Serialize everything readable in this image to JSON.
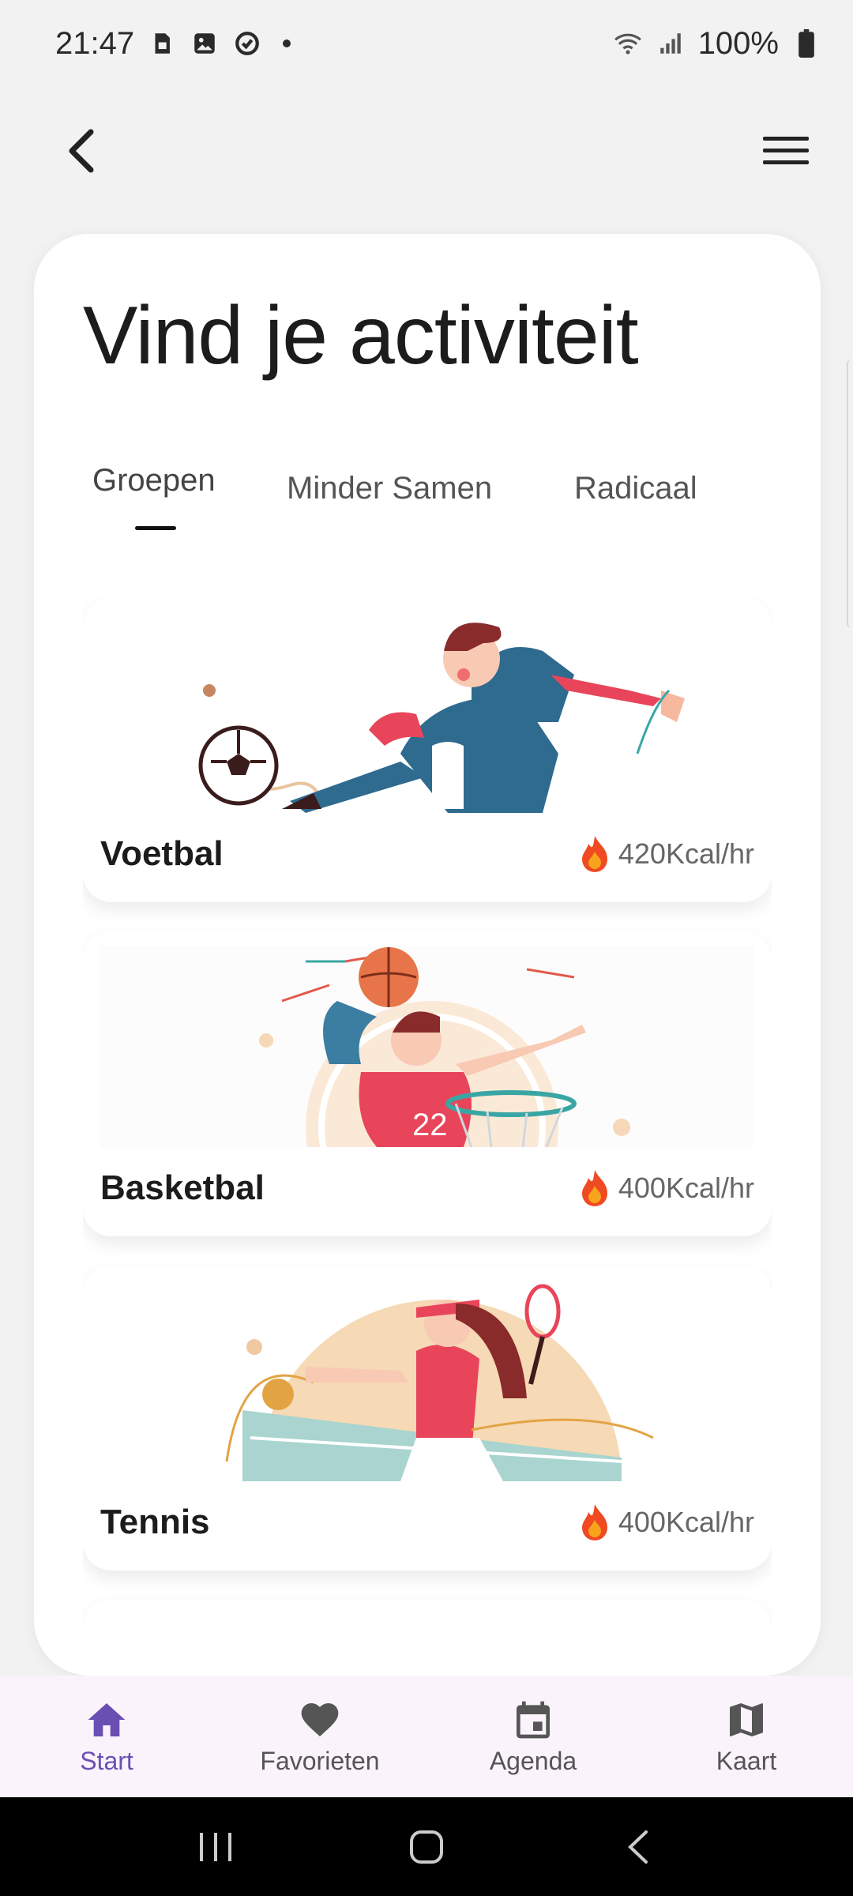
{
  "status_bar": {
    "time": "21:47",
    "battery": "100%",
    "icons": [
      "sim-icon",
      "gallery-icon",
      "sync-icon",
      "wifi-icon",
      "signal-icon",
      "battery-icon"
    ]
  },
  "app_bar": {
    "back_icon": "chevron-left-icon",
    "menu_icon": "hamburger-menu-icon"
  },
  "main": {
    "title": "Vind je activiteit",
    "tabs": [
      {
        "label": "Groepen",
        "active": true
      },
      {
        "label": "Minder Samen",
        "active": false
      },
      {
        "label": "Radicaal",
        "active": false
      }
    ],
    "activities": [
      {
        "name": "Voetbal",
        "kcal": "420Kcal/hr",
        "icon": "soccer-illustration"
      },
      {
        "name": "Basketbal",
        "kcal": "400Kcal/hr",
        "icon": "basketball-illustration"
      },
      {
        "name": "Tennis",
        "kcal": "400Kcal/hr",
        "icon": "tennis-illustration"
      }
    ]
  },
  "bottom_nav": {
    "items": [
      {
        "label": "Start",
        "icon": "home-icon",
        "active": true
      },
      {
        "label": "Favorieten",
        "icon": "heart-icon",
        "active": false
      },
      {
        "label": "Agenda",
        "icon": "calendar-icon",
        "active": false
      },
      {
        "label": "Kaart",
        "icon": "map-icon",
        "active": false
      }
    ]
  },
  "colors": {
    "accent": "#6a4fb3",
    "background": "#f2f2f3",
    "nav_background": "#fbf3fb",
    "flame": "#f04a23"
  }
}
